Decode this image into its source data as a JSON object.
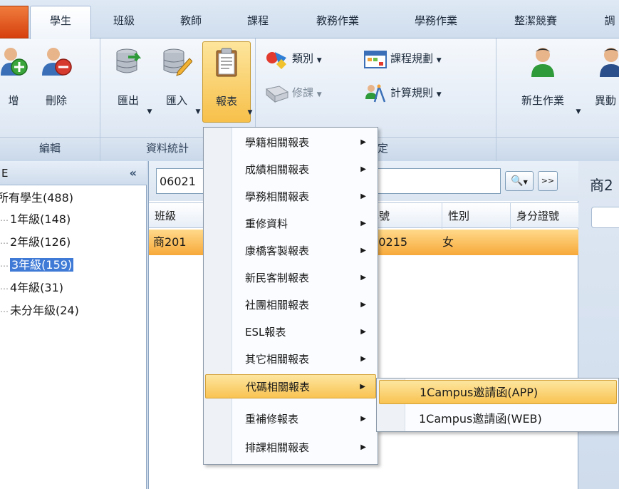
{
  "tabs": [
    {
      "label": "學生",
      "active": true
    },
    {
      "label": "班級"
    },
    {
      "label": "教師"
    },
    {
      "label": "課程"
    },
    {
      "label": "教務作業"
    },
    {
      "label": "學務作業"
    },
    {
      "label": "整潔競賽"
    },
    {
      "label": "調"
    }
  ],
  "ribbon": {
    "edit_group": {
      "label": "編輯",
      "add_label": "增",
      "delete_label": "刪除"
    },
    "data_group": {
      "label": "資料統計",
      "export_label": "匯出",
      "import_label": "匯入",
      "report_label": "報表"
    },
    "settings_group": {
      "label": "定",
      "category_label": "類別",
      "course_plan_label": "課程規劃",
      "elective_label": "修課",
      "calc_rule_label": "計算規則"
    },
    "new_student_label": "新生作業",
    "change_label": "異動"
  },
  "left_panel": {
    "header": "E",
    "collapse": "«",
    "tree": [
      {
        "label": "所有學生(488)"
      },
      {
        "label": "1年級(148)"
      },
      {
        "label": "2年級(126)"
      },
      {
        "label": "3年級(159)",
        "selected": true
      },
      {
        "label": "4年級(31)"
      },
      {
        "label": "未分年級(24)"
      }
    ]
  },
  "search": {
    "value": "06021",
    "nav": ">>"
  },
  "grid": {
    "headers": [
      "班級",
      "學號",
      "性別",
      "身分證號"
    ],
    "row": {
      "class": "商201",
      "student_no": "060215",
      "gender": "女"
    }
  },
  "right_panel": {
    "title": "商2"
  },
  "menu": {
    "items": [
      {
        "label": "學籍相關報表"
      },
      {
        "label": "成績相關報表"
      },
      {
        "label": "學務相關報表"
      },
      {
        "label": "重修資料"
      },
      {
        "label": "康橋客製報表"
      },
      {
        "label": "新民客制報表"
      },
      {
        "label": "社團相關報表"
      },
      {
        "label": "ESL報表"
      },
      {
        "label": "其它相關報表"
      },
      {
        "label": "代碼相關報表",
        "hover": true
      },
      {
        "label": "重補修報表"
      },
      {
        "label": "排課相關報表"
      }
    ]
  },
  "submenu": {
    "items": [
      {
        "label": "1Campus邀請函(APP)",
        "hover": true
      },
      {
        "label": "1Campus邀請函(WEB)"
      }
    ]
  }
}
